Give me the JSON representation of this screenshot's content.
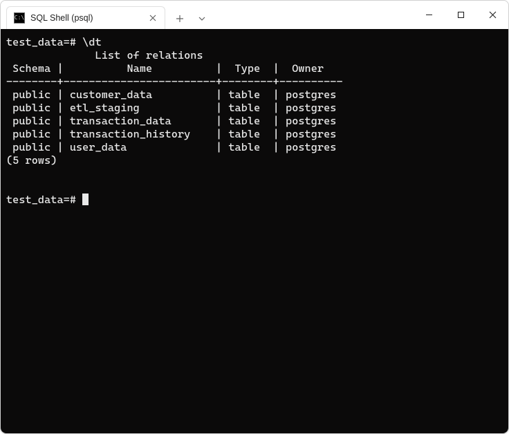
{
  "window": {
    "tab": {
      "icon_text": "C:\\",
      "title": "SQL Shell (psql)",
      "close_label": "✕"
    },
    "new_tab_label": "+",
    "dropdown_label": "⌄",
    "controls": {
      "minimize": "—",
      "maximize": "▢",
      "close": "✕"
    }
  },
  "terminal": {
    "prompt1": "test_data=#",
    "command": "\\dt",
    "list_heading_indent": "              ",
    "list_heading": "List of relations",
    "columns": {
      "schema": "Schema",
      "name": "Name",
      "type": "Type",
      "owner": "Owner"
    },
    "header_line": " Schema |          Name          |  Type  |  Owner",
    "separator": "--------+------------------------+--------+----------",
    "rows": [
      {
        "schema": "public",
        "name": "customer_data",
        "type": "table",
        "owner": "postgres"
      },
      {
        "schema": "public",
        "name": "etl_staging",
        "type": "table",
        "owner": "postgres"
      },
      {
        "schema": "public",
        "name": "transaction_data",
        "type": "table",
        "owner": "postgres"
      },
      {
        "schema": "public",
        "name": "transaction_history",
        "type": "table",
        "owner": "postgres"
      },
      {
        "schema": "public",
        "name": "user_data",
        "type": "table",
        "owner": "postgres"
      }
    ],
    "row_lines": [
      " public | customer_data          | table  | postgres",
      " public | etl_staging            | table  | postgres",
      " public | transaction_data       | table  | postgres",
      " public | transaction_history    | table  | postgres",
      " public | user_data              | table  | postgres"
    ],
    "row_count": "(5 rows)",
    "prompt2": "test_data=# "
  }
}
